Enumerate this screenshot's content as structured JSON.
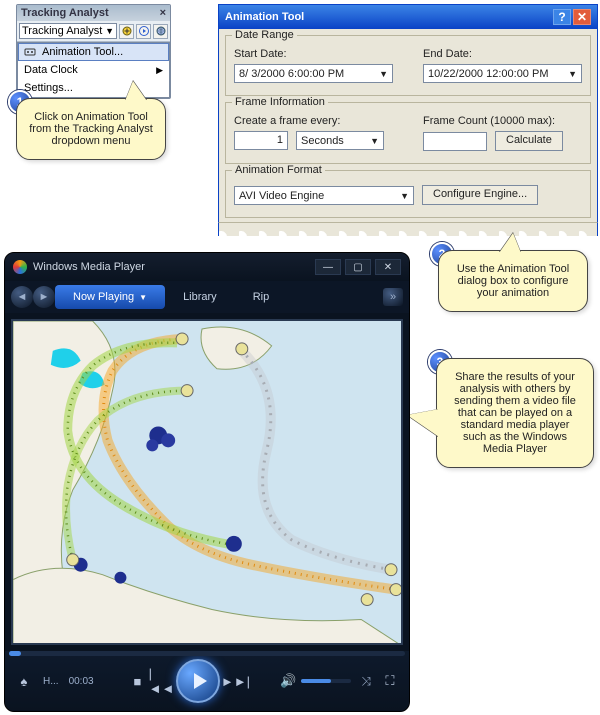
{
  "tracking": {
    "title": "Tracking Analyst",
    "combo": "Tracking Analyst",
    "menu": {
      "animation": "Animation Tool...",
      "dataclock": "Data Clock",
      "settings": "Settings..."
    }
  },
  "callouts": {
    "c1": "Click on Animation Tool from the Tracking Analyst dropdown menu",
    "c2": "Use the Animation Tool dialog box to configure your animation",
    "c3": "Share the results of your analysis with others by sending them a video file that can be played on a standard media player such as the Windows Media Player",
    "b1": "1",
    "b2": "2",
    "b3": "3"
  },
  "anim": {
    "title": "Animation Tool",
    "dateRange": {
      "group": "Date Range",
      "startLabel": "Start Date:",
      "start": "8/ 3/2000   6:00:00 PM",
      "endLabel": "End Date:",
      "end": "10/22/2000 12:00:00 PM"
    },
    "frame": {
      "group": "Frame Information",
      "createLabel": "Create a frame every:",
      "value": "1",
      "unit": "Seconds",
      "countLabel": "Frame Count (10000 max):",
      "count": "",
      "calc": "Calculate"
    },
    "format": {
      "group": "Animation Format",
      "engine": "AVI Video Engine",
      "config": "Configure Engine..."
    }
  },
  "wmp": {
    "title": "Windows Media Player",
    "tabs": {
      "now": "Now Playing",
      "library": "Library",
      "rip": "Rip"
    },
    "status": "H...",
    "time": "00:03"
  }
}
